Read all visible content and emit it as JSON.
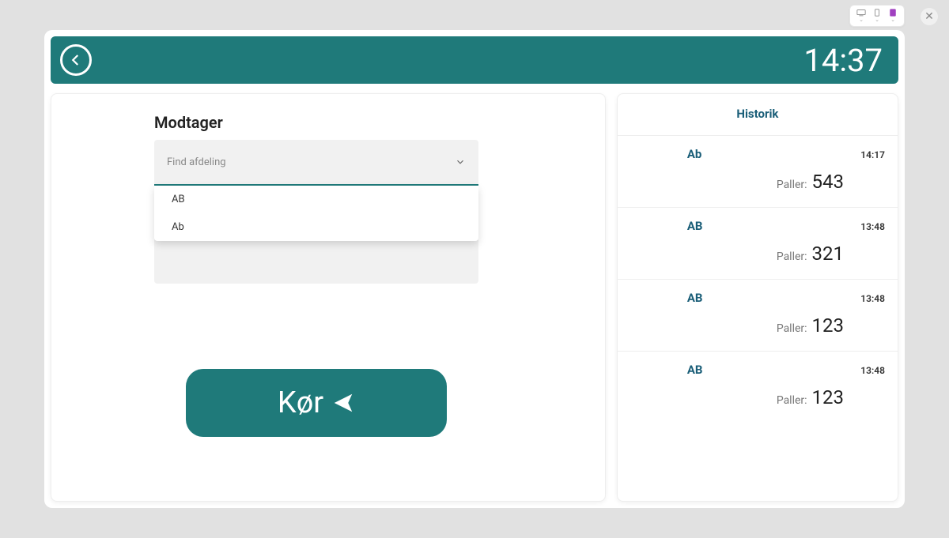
{
  "header": {
    "time": "14:37"
  },
  "main": {
    "recipient_label": "Modtager",
    "select_placeholder": "Find afdeling",
    "dropdown_options": [
      "AB",
      "Ab"
    ],
    "run_label": "Kør"
  },
  "history": {
    "title": "Historik",
    "paller_label": "Paller:",
    "items": [
      {
        "dept": "Ab",
        "time": "14:17",
        "paller": "543"
      },
      {
        "dept": "AB",
        "time": "13:48",
        "paller": "321"
      },
      {
        "dept": "AB",
        "time": "13:48",
        "paller": "123"
      },
      {
        "dept": "AB",
        "time": "13:48",
        "paller": "123"
      }
    ]
  }
}
